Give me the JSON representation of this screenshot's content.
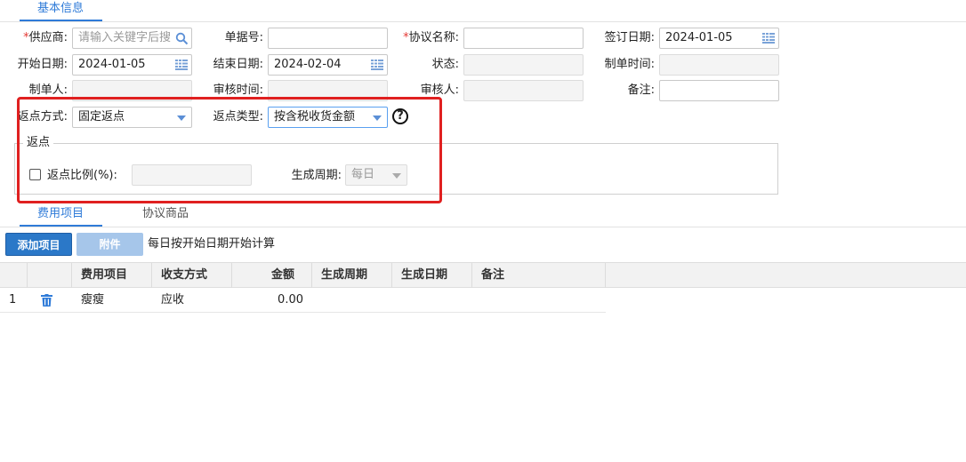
{
  "tabs_top": {
    "basic_info": "基本信息"
  },
  "form": {
    "supplier": {
      "required_mark": "*",
      "label": "供应商:",
      "placeholder": "请输入关键字后搜"
    },
    "doc_no": {
      "label": "单据号:",
      "value": ""
    },
    "agreement_name": {
      "required_mark": "*",
      "label": "协议名称:",
      "value": ""
    },
    "sign_date": {
      "label": "签订日期:",
      "value": "2024-01-05"
    },
    "start_date": {
      "label": "开始日期:",
      "value": "2024-01-05"
    },
    "end_date": {
      "label": "结束日期:",
      "value": "2024-02-04"
    },
    "status": {
      "label": "状态:",
      "value": ""
    },
    "create_time": {
      "label": "制单时间:",
      "value": ""
    },
    "creator": {
      "label": "制单人:",
      "value": ""
    },
    "audit_time": {
      "label": "审核时间:",
      "value": ""
    },
    "auditor": {
      "label": "审核人:",
      "value": ""
    },
    "remark": {
      "label": "备注:",
      "value": ""
    },
    "rebate_method": {
      "label": "返点方式:",
      "value": "固定返点"
    },
    "rebate_type": {
      "label": "返点类型:",
      "value": "按含税收货金额"
    },
    "help": "?",
    "rebate_group": {
      "legend": "返点",
      "ratio_label": "返点比例(%):",
      "ratio_value": "",
      "cycle_label": "生成周期:",
      "cycle_value": "每日"
    }
  },
  "tabs_bottom": {
    "fee_items": "费用项目",
    "agreement_goods": "协议商品"
  },
  "toolbar": {
    "add_label": "添加项目",
    "attach_label": "附件",
    "note": "每日按开始日期开始计算"
  },
  "table": {
    "columns": [
      "费用项目",
      "收支方式",
      "金额",
      "生成周期",
      "生成日期",
      "备注"
    ],
    "rows": [
      {
        "index": "1",
        "fee_item": "瘦瘦",
        "payment": "应收",
        "amount": "0.00",
        "cycle": "",
        "date": "",
        "remark": ""
      }
    ]
  },
  "colors": {
    "accent": "#2f7bd8",
    "highlight_box": "#e02020",
    "required": "#e53935"
  }
}
